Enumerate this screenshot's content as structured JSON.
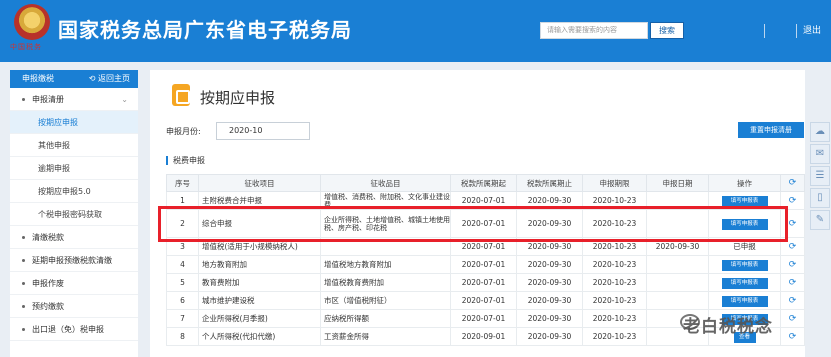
{
  "header": {
    "logo_text": "中国税务",
    "site_title": "国家税务总局广东省电子税务局",
    "search_placeholder": "请输入需要搜索的内容",
    "search_button": "搜索",
    "exit": "退出"
  },
  "sidebar": {
    "head": "申报缴税",
    "back": "返回主页",
    "items": [
      {
        "label": "申报清册"
      },
      {
        "label": "按期应申报"
      },
      {
        "label": "其他申报"
      },
      {
        "label": "逾期申报"
      },
      {
        "label": "按期应申报5.0"
      },
      {
        "label": "个税申报密码获取"
      },
      {
        "label": "清缴税款"
      },
      {
        "label": "延期申报预缴税款清缴"
      },
      {
        "label": "申报作废"
      },
      {
        "label": "预约缴款"
      },
      {
        "label": "出口退（免）税申报"
      }
    ]
  },
  "main": {
    "page_title": "按期应申报",
    "period_label": "申报月份:",
    "period_value": "2020-10",
    "refresh_button": "重置申报清册",
    "section_title": "税费申报",
    "columns": [
      "序号",
      "征收项目",
      "征收品目",
      "税款所属期起",
      "税款所属期止",
      "申报期限",
      "申报日期",
      "操作"
    ],
    "rows": [
      {
        "no": "1",
        "item": "主附税费合并申报",
        "sub": "增值税、消费税、附加税、文化事业建设费",
        "start": "2020-07-01",
        "end": "2020-09-30",
        "deadline": "2020-10-23",
        "date": "",
        "op": "填写申报表"
      },
      {
        "no": "2",
        "item": "综合申报",
        "sub": "企业所得税、土地增值税、城镇土地使用税、房产税、印花税",
        "start": "2020-07-01",
        "end": "2020-09-30",
        "deadline": "2020-10-23",
        "date": "",
        "op": "填写申报表"
      },
      {
        "no": "3",
        "item": "增值税(适用于小规模纳税人)",
        "sub": "",
        "start": "2020-07-01",
        "end": "2020-09-30",
        "deadline": "2020-10-23",
        "date": "2020-09-30",
        "op": "已申报"
      },
      {
        "no": "4",
        "item": "地方教育附加",
        "sub": "增值税地方教育附加",
        "start": "2020-07-01",
        "end": "2020-09-30",
        "deadline": "2020-10-23",
        "date": "",
        "op": "填写申报表"
      },
      {
        "no": "5",
        "item": "教育费附加",
        "sub": "增值税教育费附加",
        "start": "2020-07-01",
        "end": "2020-09-30",
        "deadline": "2020-10-23",
        "date": "",
        "op": "填写申报表"
      },
      {
        "no": "6",
        "item": "城市维护建设税",
        "sub": "市区（增值税附征）",
        "start": "2020-07-01",
        "end": "2020-09-30",
        "deadline": "2020-10-23",
        "date": "",
        "op": "填写申报表"
      },
      {
        "no": "7",
        "item": "企业所得税(月季报)",
        "sub": "应纳税所得额",
        "start": "2020-07-01",
        "end": "2020-09-30",
        "deadline": "2020-10-23",
        "date": "",
        "op": "填写申报表"
      },
      {
        "no": "8",
        "item": "个人所得税(代扣代缴)",
        "sub": "工资薪金所得",
        "start": "2020-09-01",
        "end": "2020-09-30",
        "deadline": "2020-10-23",
        "date": "",
        "op": "查看"
      }
    ]
  },
  "watermark": "老白税税念"
}
